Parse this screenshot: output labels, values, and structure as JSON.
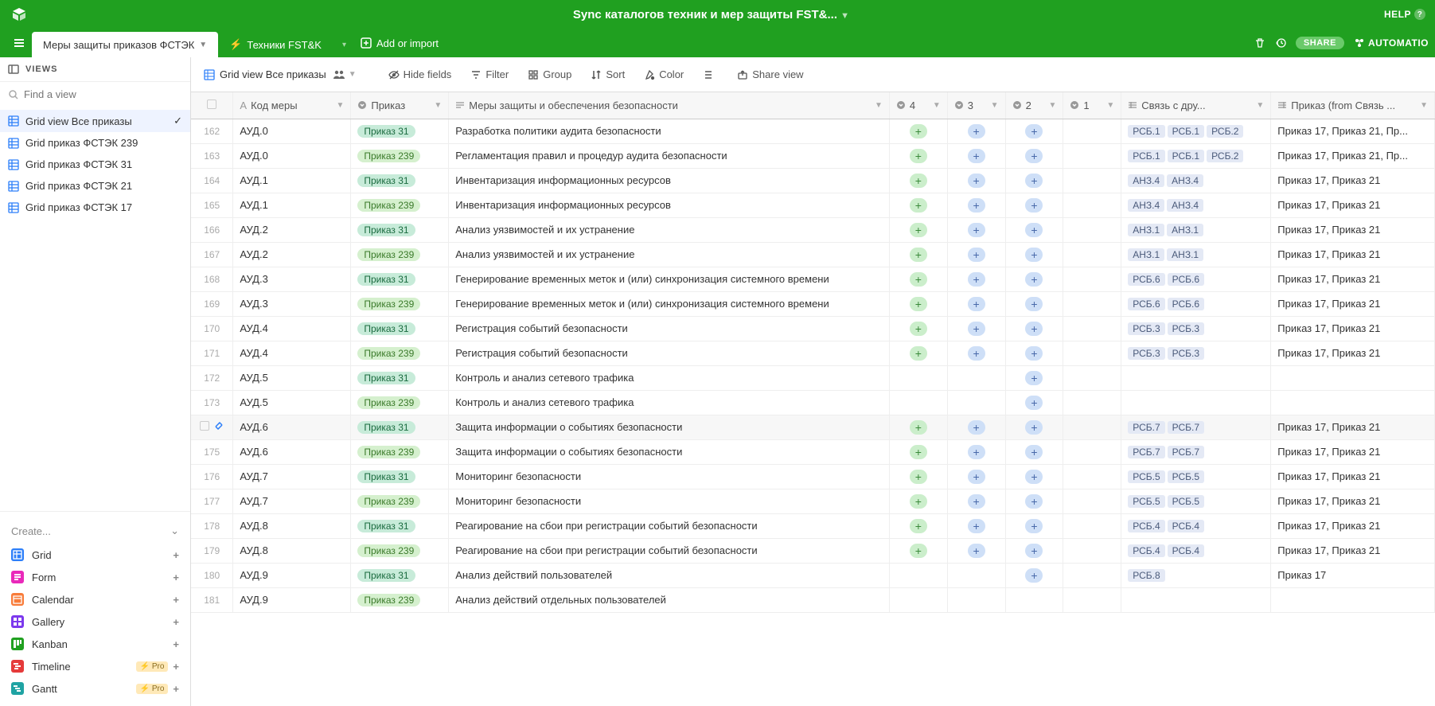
{
  "header": {
    "title": "Sync каталогов техник и мер защиты FST&...",
    "help": "HELP"
  },
  "tabs": {
    "active": "Меры защиты приказов ФСТЭК",
    "inactive": "Техники FST&K",
    "add_import": "Add or import"
  },
  "right_actions": {
    "share": "SHARE",
    "automation": "AUTOMATIO"
  },
  "sidebar": {
    "views_label": "VIEWS",
    "find_placeholder": "Find a view",
    "views": [
      "Grid view Все приказы",
      "Grid приказ ФСТЭК 239",
      "Grid приказ ФСТЭК 31",
      "Grid приказ ФСТЭК 21",
      "Grid приказ ФСТЭК 17"
    ],
    "create_label": "Create...",
    "create_items": [
      {
        "label": "Grid",
        "color": "#2d7ff9",
        "pro": false
      },
      {
        "label": "Form",
        "color": "#e929ba",
        "pro": false
      },
      {
        "label": "Calendar",
        "color": "#f87c3a",
        "pro": false
      },
      {
        "label": "Gallery",
        "color": "#7c39ed",
        "pro": false
      },
      {
        "label": "Kanban",
        "color": "#20a020",
        "pro": false
      },
      {
        "label": "Timeline",
        "color": "#e53a3a",
        "pro": true
      },
      {
        "label": "Gantt",
        "color": "#1fa3a3",
        "pro": true
      }
    ],
    "pro_label": "Pro"
  },
  "toolbar": {
    "view_name": "Grid view Все приказы",
    "hide_fields": "Hide fields",
    "filter": "Filter",
    "group": "Group",
    "sort": "Sort",
    "color": "Color",
    "share_view": "Share view"
  },
  "columns": {
    "code": "Код меры",
    "prikaz": "Приказ",
    "mery": "Меры защиты и обеспечения безопасности",
    "c4": "4",
    "c3": "3",
    "c2": "2",
    "c1": "1",
    "link": "Связь с дру...",
    "prikazfrom": "Приказ (from Связь ..."
  },
  "rows": [
    {
      "num": "162",
      "code": "АУД.0",
      "prikaz": "Приказ  31",
      "pclass": "pill-31",
      "mery": "Разработка политики аудита безопасности",
      "p4": true,
      "p3": true,
      "p2": true,
      "p1": false,
      "tags": [
        "РСБ.1",
        "РСБ.1",
        "РСБ.2"
      ],
      "from": "Приказ 17, Приказ 21, Пр..."
    },
    {
      "num": "163",
      "code": "АУД.0",
      "prikaz": "Приказ 239",
      "pclass": "pill-239",
      "mery": "Регламентация правил и процедур аудита безопасности",
      "p4": true,
      "p3": true,
      "p2": true,
      "p1": false,
      "tags": [
        "РСБ.1",
        "РСБ.1",
        "РСБ.2"
      ],
      "from": "Приказ 17, Приказ 21, Пр..."
    },
    {
      "num": "164",
      "code": "АУД.1",
      "prikaz": "Приказ  31",
      "pclass": "pill-31",
      "mery": "Инвентаризация информационных ресурсов",
      "p4": true,
      "p3": true,
      "p2": true,
      "p1": false,
      "tags": [
        "АНЗ.4",
        "АНЗ.4"
      ],
      "from": "Приказ 17, Приказ 21"
    },
    {
      "num": "165",
      "code": "АУД.1",
      "prikaz": "Приказ 239",
      "pclass": "pill-239",
      "mery": "Инвентаризация информационных ресурсов",
      "p4": true,
      "p3": true,
      "p2": true,
      "p1": false,
      "tags": [
        "АНЗ.4",
        "АНЗ.4"
      ],
      "from": "Приказ 17, Приказ 21"
    },
    {
      "num": "166",
      "code": "АУД.2",
      "prikaz": "Приказ  31",
      "pclass": "pill-31",
      "mery": "Анализ уязвимостей и их устранение",
      "p4": true,
      "p3": true,
      "p2": true,
      "p1": false,
      "tags": [
        "АНЗ.1",
        "АНЗ.1"
      ],
      "from": "Приказ 17, Приказ 21"
    },
    {
      "num": "167",
      "code": "АУД.2",
      "prikaz": "Приказ 239",
      "pclass": "pill-239",
      "mery": "Анализ уязвимостей и их устранение",
      "p4": true,
      "p3": true,
      "p2": true,
      "p1": false,
      "tags": [
        "АНЗ.1",
        "АНЗ.1"
      ],
      "from": "Приказ 17, Приказ 21"
    },
    {
      "num": "168",
      "code": "АУД.3",
      "prikaz": "Приказ  31",
      "pclass": "pill-31",
      "mery": "Генерирование временных меток и (или) синхронизация системного времени",
      "p4": true,
      "p3": true,
      "p2": true,
      "p1": false,
      "tags": [
        "РСБ.6",
        "РСБ.6"
      ],
      "from": "Приказ 17, Приказ 21"
    },
    {
      "num": "169",
      "code": "АУД.3",
      "prikaz": "Приказ 239",
      "pclass": "pill-239",
      "mery": "Генерирование временных меток и (или) синхронизация системного времени",
      "p4": true,
      "p3": true,
      "p2": true,
      "p1": false,
      "tags": [
        "РСБ.6",
        "РСБ.6"
      ],
      "from": "Приказ 17, Приказ 21"
    },
    {
      "num": "170",
      "code": "АУД.4",
      "prikaz": "Приказ  31",
      "pclass": "pill-31",
      "mery": "Регистрация событий безопасности",
      "p4": true,
      "p3": true,
      "p2": true,
      "p1": false,
      "tags": [
        "РСБ.3",
        "РСБ.3"
      ],
      "from": "Приказ 17, Приказ 21"
    },
    {
      "num": "171",
      "code": "АУД.4",
      "prikaz": "Приказ 239",
      "pclass": "pill-239",
      "mery": "Регистрация событий безопасности",
      "p4": true,
      "p3": true,
      "p2": true,
      "p1": false,
      "tags": [
        "РСБ.3",
        "РСБ.3"
      ],
      "from": "Приказ 17, Приказ 21"
    },
    {
      "num": "172",
      "code": "АУД.5",
      "prikaz": "Приказ  31",
      "pclass": "pill-31",
      "mery": "Контроль и анализ сетевого трафика",
      "p4": false,
      "p3": false,
      "p2": true,
      "p1": false,
      "tags": [],
      "from": ""
    },
    {
      "num": "173",
      "code": "АУД.5",
      "prikaz": "Приказ 239",
      "pclass": "pill-239",
      "mery": "Контроль и анализ сетевого трафика",
      "p4": false,
      "p3": false,
      "p2": true,
      "p1": false,
      "tags": [],
      "from": ""
    },
    {
      "num": "",
      "code": "АУД.6",
      "prikaz": "Приказ  31",
      "pclass": "pill-31",
      "mery": "Защита информации о событиях безопасности",
      "p4": true,
      "p3": true,
      "p2": true,
      "p1": false,
      "tags": [
        "РСБ.7",
        "РСБ.7"
      ],
      "from": "Приказ 17, Приказ 21",
      "hovered": true
    },
    {
      "num": "175",
      "code": "АУД.6",
      "prikaz": "Приказ 239",
      "pclass": "pill-239",
      "mery": "Защита информации о событиях безопасности",
      "p4": true,
      "p3": true,
      "p2": true,
      "p1": false,
      "tags": [
        "РСБ.7",
        "РСБ.7"
      ],
      "from": "Приказ 17, Приказ 21"
    },
    {
      "num": "176",
      "code": "АУД.7",
      "prikaz": "Приказ  31",
      "pclass": "pill-31",
      "mery": "Мониторинг безопасности",
      "p4": true,
      "p3": true,
      "p2": true,
      "p1": false,
      "tags": [
        "РСБ.5",
        "РСБ.5"
      ],
      "from": "Приказ 17, Приказ 21"
    },
    {
      "num": "177",
      "code": "АУД.7",
      "prikaz": "Приказ 239",
      "pclass": "pill-239",
      "mery": "Мониторинг безопасности",
      "p4": true,
      "p3": true,
      "p2": true,
      "p1": false,
      "tags": [
        "РСБ.5",
        "РСБ.5"
      ],
      "from": "Приказ 17, Приказ 21"
    },
    {
      "num": "178",
      "code": "АУД.8",
      "prikaz": "Приказ  31",
      "pclass": "pill-31",
      "mery": "Реагирование на сбои при регистрации событий безопасности",
      "p4": true,
      "p3": true,
      "p2": true,
      "p1": false,
      "tags": [
        "РСБ.4",
        "РСБ.4"
      ],
      "from": "Приказ 17, Приказ 21"
    },
    {
      "num": "179",
      "code": "АУД.8",
      "prikaz": "Приказ 239",
      "pclass": "pill-239",
      "mery": "Реагирование на сбои при регистрации событий безопасности",
      "p4": true,
      "p3": true,
      "p2": true,
      "p1": false,
      "tags": [
        "РСБ.4",
        "РСБ.4"
      ],
      "from": "Приказ 17, Приказ 21"
    },
    {
      "num": "180",
      "code": "АУД.9",
      "prikaz": "Приказ  31",
      "pclass": "pill-31",
      "mery": "Анализ действий пользователей",
      "p4": false,
      "p3": false,
      "p2": true,
      "p1": false,
      "tags": [
        "РСБ.8"
      ],
      "from": "Приказ 17"
    },
    {
      "num": "181",
      "code": "АУД.9",
      "prikaz": "Приказ 239",
      "pclass": "pill-239",
      "mery": "Анализ действий отдельных пользователей",
      "p4": false,
      "p3": false,
      "p2": false,
      "p1": false,
      "tags": [],
      "from": ""
    }
  ]
}
